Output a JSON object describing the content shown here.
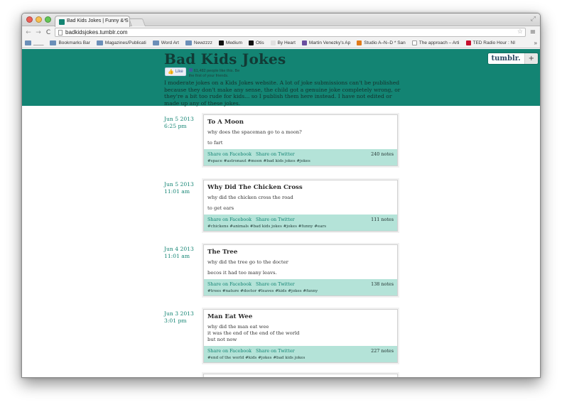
{
  "browser": {
    "tab_title": "Bad Kids Jokes | Funny & S",
    "tab_close": "×",
    "url": "badkidsjokes.tumblr.com",
    "nav": {
      "back": "←",
      "forward": "→",
      "reload": "C",
      "star": "☆",
      "menu": "≡",
      "resize": "⤢"
    },
    "bookmarks": [
      {
        "label": "____",
        "icon": "folder-icon"
      },
      {
        "label": "Bookmarks Bar",
        "icon": "folder-icon"
      },
      {
        "label": "Magazines/Publicati",
        "icon": "folder-icon"
      },
      {
        "label": "Word Art",
        "icon": "folder-icon"
      },
      {
        "label": "Newzzzz",
        "icon": "folder-icon"
      },
      {
        "label": "Medium",
        "icon": "medium-icon"
      },
      {
        "label": "Otis",
        "icon": "otis-icon"
      },
      {
        "label": "By Heart",
        "icon": "heart-icon"
      },
      {
        "label": "Martin Venezky's Ap",
        "icon": "person-icon"
      },
      {
        "label": "Studio A–N–D * San",
        "icon": "studio-icon"
      },
      {
        "label": "The approach – Arti",
        "icon": "page-icon"
      },
      {
        "label": "TED Radio Hour : NI",
        "icon": "ted-icon"
      }
    ],
    "bookmarks_more": "»"
  },
  "blog": {
    "title": "Bad Kids Jokes",
    "like_label": "Like",
    "like_text": "61,482 people like this. Be the first of your friends.",
    "description": "I moderate jokes on a Kids Jokes website. A lot of joke submissions can't be published because they don't make any sense, the child got a genuine joke completely wrong, or they're a bit too rude for kids... so I publish them here instead. I have not edited or made up any of these jokes.",
    "tumblr_logo": "tumblr.",
    "tumblr_plus": "+"
  },
  "posts": [
    {
      "date": "Jun 5 2013",
      "time": "6:25 pm",
      "title": "To A Moon",
      "lines": [
        "why does the spaceman go to a moon?"
      ],
      "punchline": "to fart",
      "share_facebook": "Share on Facebook",
      "share_twitter": "Share on Twitter",
      "notes": "240 notes",
      "tags": "#space #astronaut #moon #bad kids jokes #jokes"
    },
    {
      "date": "Jun 5 2013",
      "time": "11:01 am",
      "title": "Why Did The Chicken Cross",
      "lines": [
        "why did the chicken cross the road"
      ],
      "punchline": "to get ears",
      "share_facebook": "Share on Facebook",
      "share_twitter": "Share on Twitter",
      "notes": "111 notes",
      "tags": "#chickens #animals #bad kids jokes #jokes #funny #ears"
    },
    {
      "date": "Jun 4 2013",
      "time": "11:01 am",
      "title": "The Tree",
      "lines": [
        "why did the tree go to the docter"
      ],
      "punchline": "becos it had too many leavs.",
      "share_facebook": "Share on Facebook",
      "share_twitter": "Share on Twitter",
      "notes": "138 notes",
      "tags": "#trees #nature #doctor #leaves #kids #jokes #funny"
    },
    {
      "date": "Jun 3 2013",
      "time": "3:01 pm",
      "title": "Man Eat Wee",
      "lines": [
        "why did the man eat wee",
        "it was the end of the end of the world",
        "but not now"
      ],
      "punchline": "",
      "share_facebook": "Share on Facebook",
      "share_twitter": "Share on Twitter",
      "notes": "227 notes",
      "tags": "#end of the world #kids #jokes #bad kids jokes"
    }
  ],
  "colors": {
    "header_bg": "#138473",
    "footer_bg": "#b4e3d8",
    "link": "#138473"
  }
}
